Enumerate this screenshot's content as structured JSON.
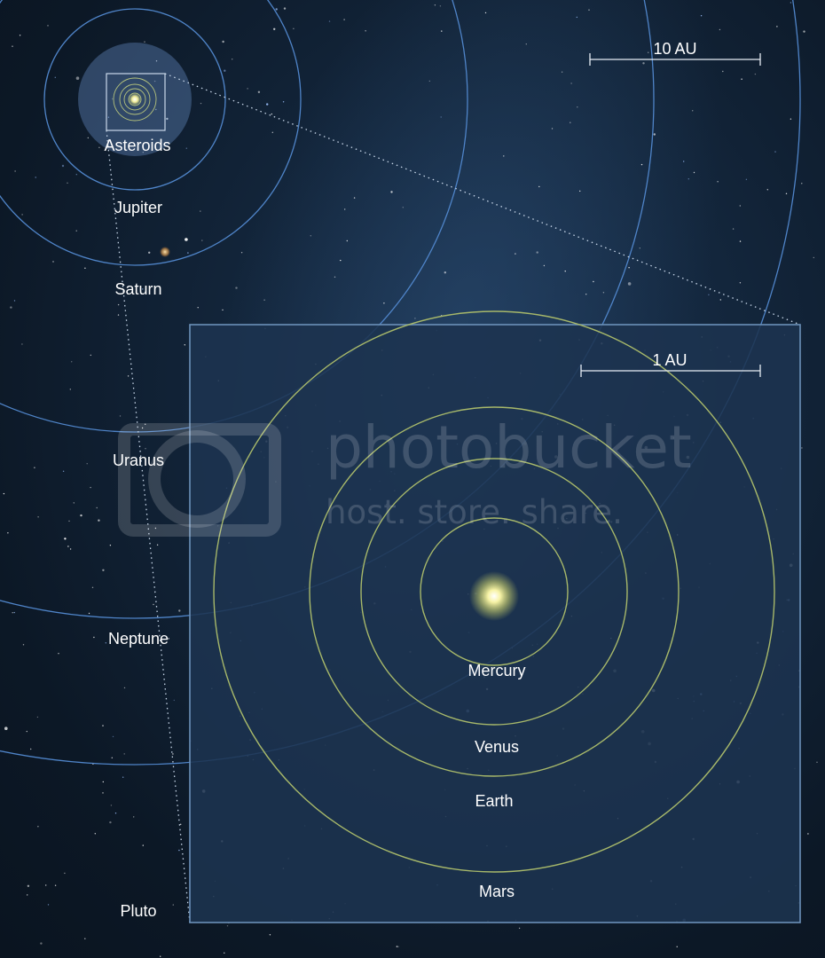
{
  "outer": {
    "scale_label": "10 AU",
    "labels": {
      "asteroids": "Asteroids",
      "jupiter": "Jupiter",
      "saturn": "Saturn",
      "uranus": "Uranus",
      "neptune": "Neptune",
      "pluto": "Pluto"
    }
  },
  "inset": {
    "scale_label": "1 AU",
    "labels": {
      "mercury": "Mercury",
      "venus": "Venus",
      "earth": "Earth",
      "mars": "Mars"
    }
  },
  "watermark": {
    "title": "photobucket",
    "subtitle": "host. store. share."
  },
  "colors": {
    "outer_orbit": "#4f84c8",
    "inner_orbit": "#a7b86a",
    "inset_border": "#6b90b8",
    "sun": "#f4f0a0"
  }
}
